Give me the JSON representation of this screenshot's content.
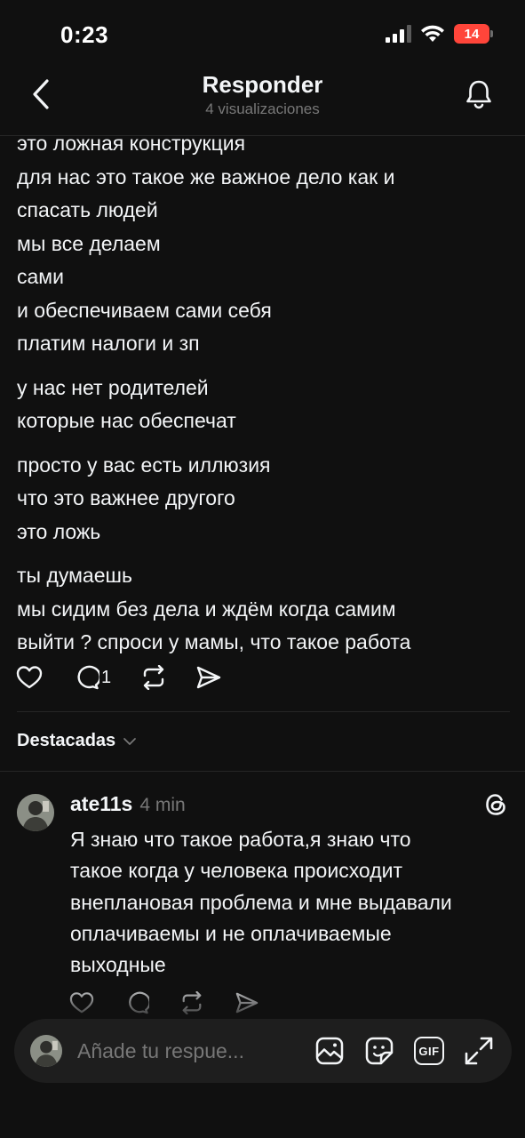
{
  "status": {
    "time": "0:23",
    "battery": "14"
  },
  "header": {
    "title": "Responder",
    "subtitle": "4 visualizaciones"
  },
  "post": {
    "paragraphs": [
      [
        "это ложная конструкция",
        "для нас это такое же важное дело как и",
        "спасать людей",
        "мы все делаем",
        "сами",
        "и обеспечиваем сами себя",
        "платим налоги и зп"
      ],
      [
        "у нас нет родителей",
        "которые нас обеспечат"
      ],
      [
        "просто у вас есть иллюзия",
        "что это важнее другого",
        "это ложь"
      ],
      [
        "ты думаешь",
        "мы сидим без дела и ждём когда самим",
        "выйти ? спроси у мамы, что такое работа"
      ]
    ],
    "reply_count": "1"
  },
  "filter": {
    "label": "Destacadas"
  },
  "reply": {
    "username": "ate11s",
    "time": "4 min",
    "lines": [
      "Я знаю что такое работа,я знаю что",
      "такое когда у человека происходит",
      "внеплановая проблема и мне выдавали",
      "оплачиваемы и не оплачиваемые",
      "выходные"
    ]
  },
  "composer": {
    "placeholder": "Añade tu respue...",
    "gif_label": "GIF"
  },
  "icons": [
    "back-icon",
    "bell-icon",
    "heart-icon",
    "comment-icon",
    "repost-icon",
    "share-icon",
    "chevron-down-icon",
    "threads-icon",
    "sticker-icon",
    "image-icon",
    "gif-icon",
    "expand-icon"
  ]
}
